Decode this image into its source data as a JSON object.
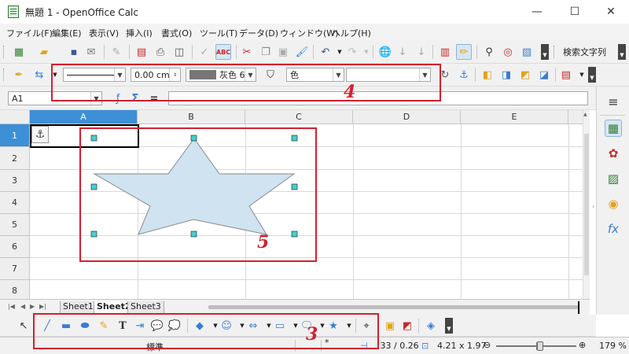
{
  "window": {
    "title": "無題 1 - OpenOffice Calc",
    "minimize_glyph": "—",
    "maximize_glyph": "☐",
    "close_glyph": "✕"
  },
  "menu": {
    "items": [
      "ファイル(F)",
      "編集(E)",
      "表示(V)",
      "挿入(I)",
      "書式(O)",
      "ツール(T)",
      "データ(D)",
      "ウィンドウ(W)",
      "ヘルプ(H)"
    ]
  },
  "standard_toolbar": {
    "search_label": "検索文字列"
  },
  "drawing_properties_toolbar": {
    "line_width": "0.00 cm",
    "line_color": "灰色 6",
    "area_style": "色",
    "area_fill": ""
  },
  "formula_bar": {
    "cell_reference": "A1",
    "equals": "=",
    "content": ""
  },
  "grid": {
    "columns": [
      "A",
      "B",
      "C",
      "D",
      "E"
    ],
    "rows": [
      "1",
      "2",
      "3",
      "4",
      "5",
      "6",
      "7",
      "8"
    ],
    "active_column": "A",
    "active_row": "1"
  },
  "shape": {
    "type": "star",
    "fill_color": "#cfe3f1",
    "stroke_color": "#8a8a8a",
    "handle_color": "#40d0d0"
  },
  "sheet_tabs": [
    "Sheet1",
    "Sheet2",
    "Sheet3"
  ],
  "active_sheet": "Sheet2",
  "status_bar": {
    "page_style": "標準",
    "position": ".33 / 0.26",
    "size": "4.21 x 1.97",
    "zoom_percent": "179 %",
    "zoom_fraction": 0.55
  },
  "annotations": {
    "box3_label": "3",
    "box4_label": "4",
    "box5_label": "5",
    "color": "#d2202f"
  },
  "icons": {
    "anchor": "anchor-icon",
    "sidebar": [
      "properties-icon",
      "styles-icon",
      "gallery-icon",
      "navigator-icon",
      "functions-icon"
    ]
  }
}
